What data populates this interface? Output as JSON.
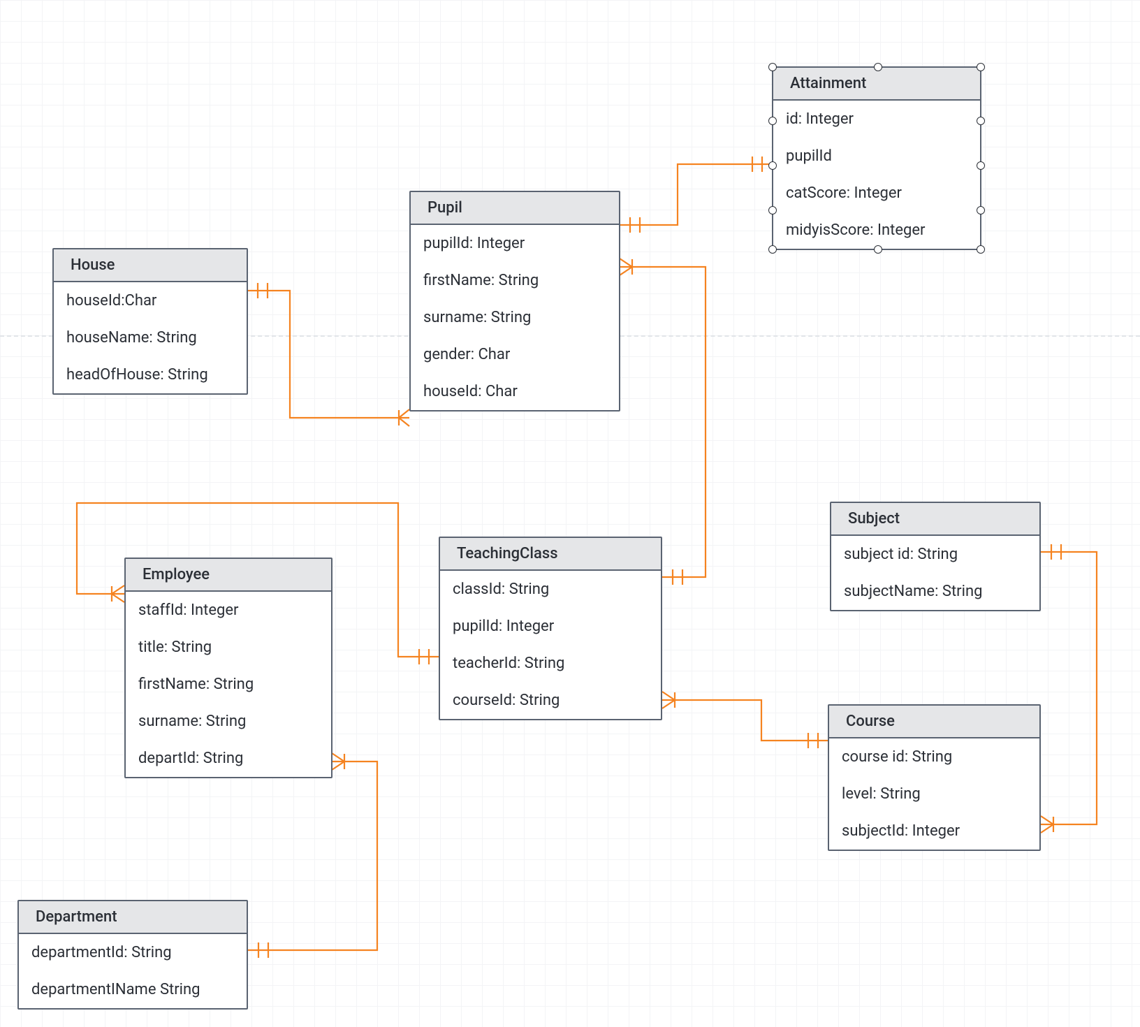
{
  "entities": {
    "house": {
      "title": "House",
      "fields": [
        "houseId:Char",
        "houseName: String",
        "headOfHouse: String"
      ]
    },
    "pupil": {
      "title": "Pupil",
      "fields": [
        "pupilId: Integer",
        "firstName: String",
        "surname: String",
        "gender: Char",
        "houseId: Char"
      ]
    },
    "attainment": {
      "title": "Attainment",
      "fields": [
        "id: Integer",
        "pupilId",
        "catScore: Integer",
        "midyisScore: Integer"
      ]
    },
    "employee": {
      "title": "Employee",
      "fields": [
        "staffId: Integer",
        "title: String",
        "firstName: String",
        "surname: String",
        "departId: String"
      ]
    },
    "teachingclass": {
      "title": "TeachingClass",
      "fields": [
        "classId: String",
        "pupilId: Integer",
        "teacherId: String",
        "courseId: String"
      ]
    },
    "subject": {
      "title": "Subject",
      "fields": [
        "subject id: String",
        "subjectName: String"
      ]
    },
    "course": {
      "title": "Course",
      "fields": [
        "course id: String",
        "level: String",
        "subjectId: Integer"
      ]
    },
    "department": {
      "title": "Department",
      "fields": [
        "departmentId: String",
        "departmentIName String"
      ]
    }
  },
  "relationships": [
    {
      "from": "House",
      "to": "Pupil",
      "type": "one-to-many"
    },
    {
      "from": "Pupil",
      "to": "Attainment",
      "type": "one-to-one"
    },
    {
      "from": "Pupil",
      "to": "TeachingClass",
      "type": "one-to-many"
    },
    {
      "from": "Employee",
      "to": "TeachingClass",
      "type": "one-to-many"
    },
    {
      "from": "TeachingClass",
      "to": "Course",
      "type": "many-to-one"
    },
    {
      "from": "Course",
      "to": "Subject",
      "type": "many-to-one"
    },
    {
      "from": "Department",
      "to": "Employee",
      "type": "one-to-many"
    }
  ],
  "colors": {
    "connector": "#f58320",
    "border": "#5a6371",
    "headerBg": "#e5e6e8"
  }
}
